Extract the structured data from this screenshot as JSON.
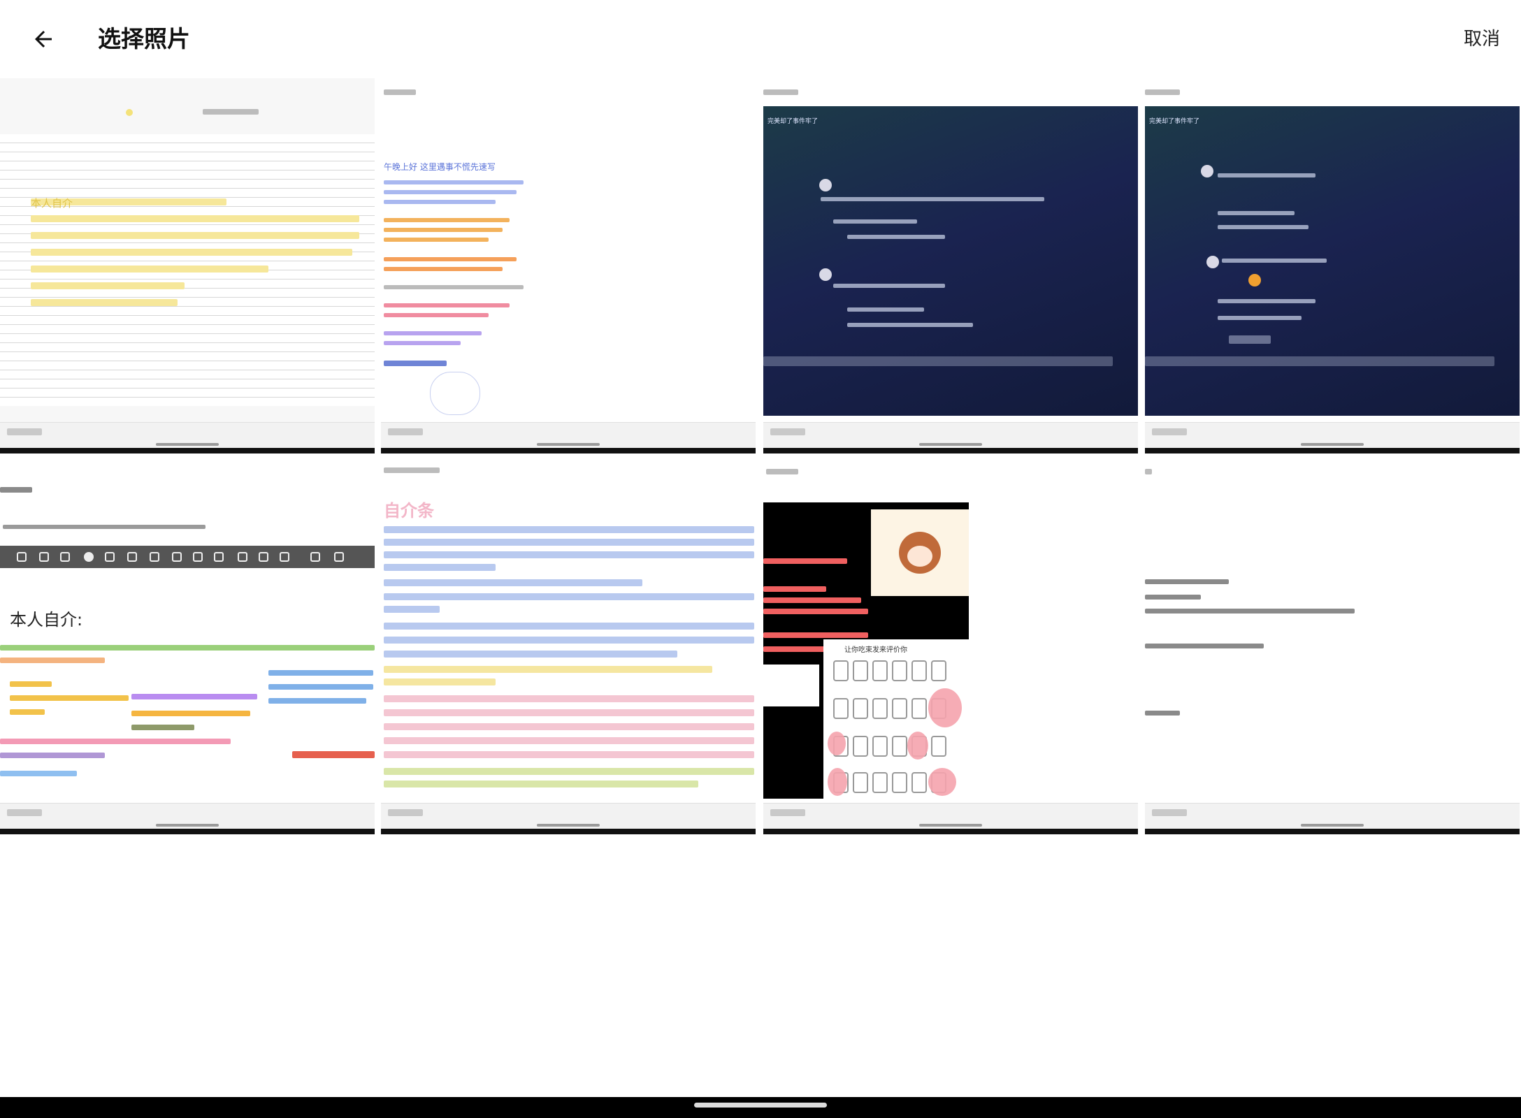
{
  "header": {
    "back_icon": "arrow-left-icon",
    "title": "选择照片",
    "cancel_label": "取消"
  },
  "photos": [
    {
      "caption": "本人自介",
      "theme": "lined-notes"
    },
    {
      "caption": "午晚上好 这里遇事不慌先速写",
      "theme": "colorful-post"
    },
    {
      "caption": "完美却了事件牢了",
      "theme": "dark-comments"
    },
    {
      "caption": "完美却了事件牢了",
      "theme": "dark-comments"
    },
    {
      "caption": "本人自介:",
      "theme": "intro-toolbar"
    },
    {
      "caption": "自介条",
      "theme": "pastel-post"
    },
    {
      "caption": "让你吃束发来评价你",
      "theme": "anime-jars"
    },
    {
      "caption": "",
      "theme": "plain-doc"
    }
  ],
  "colors": {
    "background": "#ffffff",
    "navbar": "#000000",
    "dark_card_top": "#1c3b48",
    "dark_card_bottom": "#121a3a"
  }
}
